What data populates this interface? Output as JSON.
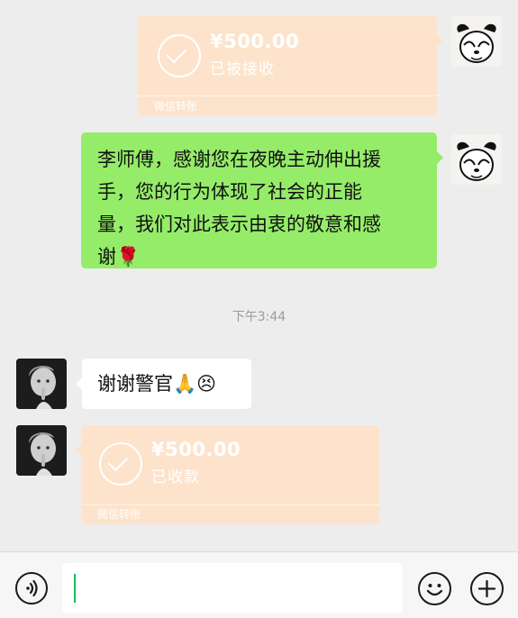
{
  "chat": {
    "transfer_1": {
      "amount": "¥500.00",
      "status": "已被接收",
      "footer": "微信转账"
    },
    "msg_sent": {
      "text_line1": "李师傅，感谢您在夜晚主动伸出援",
      "text_line2": "手，您的行为体现了社会的正能",
      "text_line3": "量，我们对此表示由衷的敬意和感",
      "text_line4": "谢🌹"
    },
    "timestamp": "下午3:44",
    "msg_reply": {
      "text": "谢谢警官🙏😣"
    },
    "transfer_2": {
      "amount": "¥500.00",
      "status": "已收款",
      "footer": "微信转账"
    }
  },
  "input_bar": {
    "voice_icon": "voice-icon",
    "emoji_icon": "emoji-icon",
    "plus_icon": "plus-icon",
    "input_value": ""
  },
  "colors": {
    "background": "#ededed",
    "sent_bubble": "#95ec69",
    "transfer_card": "#fde3cc",
    "caret": "#07c160"
  }
}
